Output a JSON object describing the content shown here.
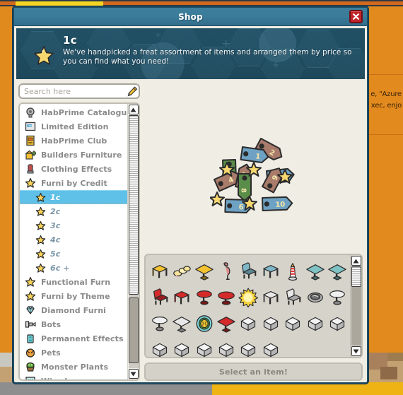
{
  "window": {
    "title": "Shop",
    "close_label": "x"
  },
  "banner": {
    "icon": "star-icon",
    "title": "1c",
    "description": "We've handpicked a freat assortment of items and arranged them by price so you can find what you need!"
  },
  "search": {
    "value": "",
    "placeholder": "Search here",
    "icon": "pencil-icon"
  },
  "sidebar": {
    "items": [
      {
        "label": "HabPrime Catalogue",
        "icon": "cog-catalogue-icon",
        "sub": false,
        "selected": false
      },
      {
        "label": "Limited Edition",
        "icon": "ltd-book-icon",
        "sub": false,
        "selected": false
      },
      {
        "label": "HabPrime Club",
        "icon": "club-machine-icon",
        "sub": false,
        "selected": false
      },
      {
        "label": "Builders Furniture",
        "icon": "builders-icon",
        "sub": false,
        "selected": false
      },
      {
        "label": "Clothing Effects",
        "icon": "clothing-icon",
        "sub": false,
        "selected": false
      },
      {
        "label": "Furni by Credit",
        "icon": "star-icon",
        "sub": false,
        "selected": false
      },
      {
        "label": "1c",
        "icon": "star-icon",
        "sub": true,
        "selected": true
      },
      {
        "label": "2c",
        "icon": "star-icon",
        "sub": true,
        "selected": false
      },
      {
        "label": "3c",
        "icon": "star-icon",
        "sub": true,
        "selected": false
      },
      {
        "label": "4c",
        "icon": "star-icon",
        "sub": true,
        "selected": false
      },
      {
        "label": "5c",
        "icon": "star-icon",
        "sub": true,
        "selected": false
      },
      {
        "label": "6c +",
        "icon": "star-icon",
        "sub": true,
        "selected": false
      },
      {
        "label": "Functional Furn",
        "icon": "star-icon",
        "sub": false,
        "selected": false
      },
      {
        "label": "Furni by Theme",
        "icon": "star-icon",
        "sub": false,
        "selected": false
      },
      {
        "label": "Diamond Furni",
        "icon": "diamond-icon",
        "sub": false,
        "selected": false
      },
      {
        "label": "Bots",
        "icon": "bot-icon",
        "sub": false,
        "selected": false
      },
      {
        "label": "Permanent Effects",
        "icon": "effects-icon",
        "sub": false,
        "selected": false
      },
      {
        "label": "Pets",
        "icon": "pet-icon",
        "sub": false,
        "selected": false
      },
      {
        "label": "Monster Plants",
        "icon": "plant-icon",
        "sub": false,
        "selected": false
      },
      {
        "label": "Wired",
        "icon": "wired-icon",
        "sub": false,
        "selected": false
      }
    ],
    "scroll": {
      "up_arrow": "▲",
      "down_arrow": "▼",
      "thumb_position_pct": 78
    }
  },
  "preview": {
    "art_name": "price-tags-artwork",
    "tag_numbers": [
      "1",
      "2",
      "3",
      "4",
      "5",
      "6",
      "7",
      "8",
      "9",
      "10"
    ]
  },
  "item_grid": {
    "scroll": {
      "up_arrow": "▲",
      "down_arrow": "▼",
      "thumb_position_pct": 4
    },
    "items": [
      {
        "name": "yellow-stool",
        "type": "stool",
        "color": "#F2C230"
      },
      {
        "name": "yellow-cushions",
        "type": "cushions",
        "color": "#F7E49A"
      },
      {
        "name": "yellow-small-table",
        "type": "table",
        "color": "#F2C230"
      },
      {
        "name": "flamingo",
        "type": "flamingo",
        "color": "#E08A8A"
      },
      {
        "name": "blue-chair",
        "type": "chair",
        "color": "#7FB7C9"
      },
      {
        "name": "blue-stool",
        "type": "stool",
        "color": "#7FB7C9"
      },
      {
        "name": "lighthouse",
        "type": "lighthouse",
        "color": "#E03A3A"
      },
      {
        "name": "teal-small-table",
        "type": "table",
        "color": "#7FC2C4"
      },
      {
        "name": "teal-table",
        "type": "table",
        "color": "#7FC2C4"
      },
      {
        "name": "red-chair",
        "type": "chair",
        "color": "#D42A2A"
      },
      {
        "name": "red-stool",
        "type": "stool",
        "color": "#D42A2A"
      },
      {
        "name": "red-round-table",
        "type": "roundtable",
        "color": "#D42A2A"
      },
      {
        "name": "red-low-table",
        "type": "lowtable",
        "color": "#D42A2A"
      },
      {
        "name": "sun-lamp",
        "type": "sun",
        "color": "#F7D83A"
      },
      {
        "name": "white-stool",
        "type": "stool",
        "color": "#E8E8E8"
      },
      {
        "name": "white-chair",
        "type": "chair",
        "color": "#E8E8E8"
      },
      {
        "name": "stone-basin",
        "type": "basin",
        "color": "#A8A8A8"
      },
      {
        "name": "white-round-table",
        "type": "roundtable",
        "color": "#F0F0F0"
      },
      {
        "name": "white-pedestal-table",
        "type": "roundtable",
        "color": "#F0F0F0"
      },
      {
        "name": "white-table",
        "type": "table",
        "color": "#E8E8E8"
      },
      {
        "name": "gold-medallion",
        "type": "medallion",
        "color": "#E8C53A"
      },
      {
        "name": "red-table",
        "type": "table",
        "color": "#D42A2A"
      },
      {
        "name": "placeholder-cube-1",
        "type": "cube",
        "color": "#E0E0E0"
      },
      {
        "name": "placeholder-cube-2",
        "type": "cube",
        "color": "#E0E0E0"
      },
      {
        "name": "placeholder-cube-3",
        "type": "cube",
        "color": "#E0E0E0"
      },
      {
        "name": "placeholder-cube-4",
        "type": "cube",
        "color": "#E0E0E0"
      },
      {
        "name": "placeholder-cube-5",
        "type": "cube",
        "color": "#E0E0E0"
      },
      {
        "name": "placeholder-cube-6",
        "type": "cube",
        "color": "#E0E0E0"
      },
      {
        "name": "placeholder-cube-7",
        "type": "cube",
        "color": "#E0E0E0"
      },
      {
        "name": "placeholder-cube-8",
        "type": "cube",
        "color": "#E0E0E0"
      },
      {
        "name": "placeholder-cube-9",
        "type": "cube",
        "color": "#E0E0E0"
      },
      {
        "name": "placeholder-cube-10",
        "type": "cube",
        "color": "#E0E0E0"
      },
      {
        "name": "placeholder-cube-11",
        "type": "cube",
        "color": "#E0E0E0"
      }
    ]
  },
  "footer": {
    "select_label": "Select an item!"
  },
  "background": {
    "side_text_line1": "e, \"Azure",
    "side_text_line2": "xec, enjo",
    "colors": {
      "orange": "#E28A1E",
      "yellow_bar": "#F5D423",
      "window_border": "#1D4C63",
      "titlebar": "#3A7B99",
      "banner": "#1F4E63",
      "selected_row": "#5FC0E8",
      "close_red": "#C1232A"
    }
  }
}
